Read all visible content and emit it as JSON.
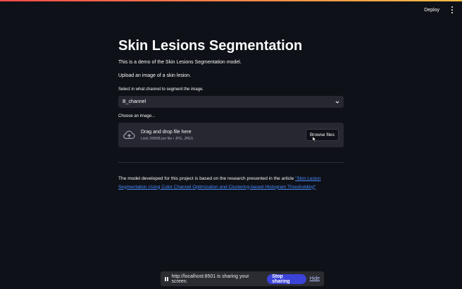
{
  "header": {
    "deploy_label": "Deploy"
  },
  "main": {
    "title": "Skin Lesions Segmentation",
    "intro": "This is a demo of the Skin Lesions Segmentation model.",
    "upload_prompt": "Upload an image of a skin lesion.",
    "channel_label": "Select in what channel to segment the image.",
    "channel_value": "B_channel",
    "image_label": "Choose an image...",
    "dropzone": {
      "title": "Drag and drop file here",
      "limit": "Limit 200MB per file • JPG, JPEG",
      "browse_label": "Browse files"
    },
    "article": {
      "prefix": "The model developed for this project is based on the research presented in the article ",
      "link_text": "\"Skin Lesion Segmentation Using Color Channel Optimization and Clustering-based Histogram Thresholding\""
    }
  },
  "share_bar": {
    "message": "http://localhost:8501 is sharing your screen.",
    "stop_label": "Stop sharing",
    "hide_label": "Hide"
  },
  "colors": {
    "accent": "#3b43d9",
    "link": "#4a8cff",
    "background": "#0e1117",
    "input_bg": "#262730"
  }
}
